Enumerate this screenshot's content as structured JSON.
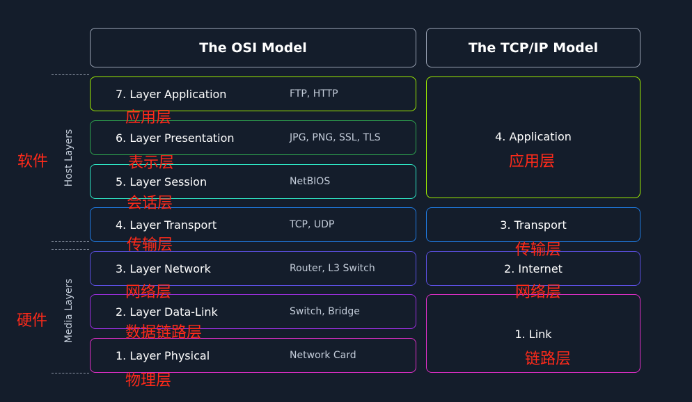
{
  "osi_header": "The OSI Model",
  "tcp_header": "The TCP/IP Model",
  "side_labels": {
    "host_en": "Host Layers",
    "host_cn": "软件",
    "media_en": "Media Layers",
    "media_cn": "硬件"
  },
  "osi_layers": [
    {
      "name": "7. Layer Application",
      "protocols": "FTP, HTTP",
      "cn": "应用层",
      "color": "#9fef00"
    },
    {
      "name": "6. Layer Presentation",
      "protocols": "JPG, PNG, SSL, TLS",
      "cn": "表示层",
      "color": "#2ea44f"
    },
    {
      "name": "5. Layer Session",
      "protocols": "NetBIOS",
      "cn": "会话层",
      "color": "#2ee6c4"
    },
    {
      "name": "4. Layer Transport",
      "protocols": "TCP, UDP",
      "cn": "传输层",
      "color": "#1f7be3"
    },
    {
      "name": "3. Layer Network",
      "protocols": "Router, L3 Switch",
      "cn": "网络层",
      "color": "#5b4fe0"
    },
    {
      "name": "2. Layer Data-Link",
      "protocols": "Switch, Bridge",
      "cn": "数据链路层",
      "color": "#9d2fe0"
    },
    {
      "name": "1. Layer Physical",
      "protocols": "Network Card",
      "cn": "物理层",
      "color": "#e02fc8"
    }
  ],
  "tcp_layers": [
    {
      "name": "4. Application",
      "cn": "应用层",
      "color": "#9fef00"
    },
    {
      "name": "3. Transport",
      "cn": "传输层",
      "color": "#1f7be3"
    },
    {
      "name": "2. Internet",
      "cn": "网络层",
      "color": "#5b4fe0"
    },
    {
      "name": "1. Link",
      "cn": "链路层",
      "color": "#e02fc8"
    }
  ]
}
